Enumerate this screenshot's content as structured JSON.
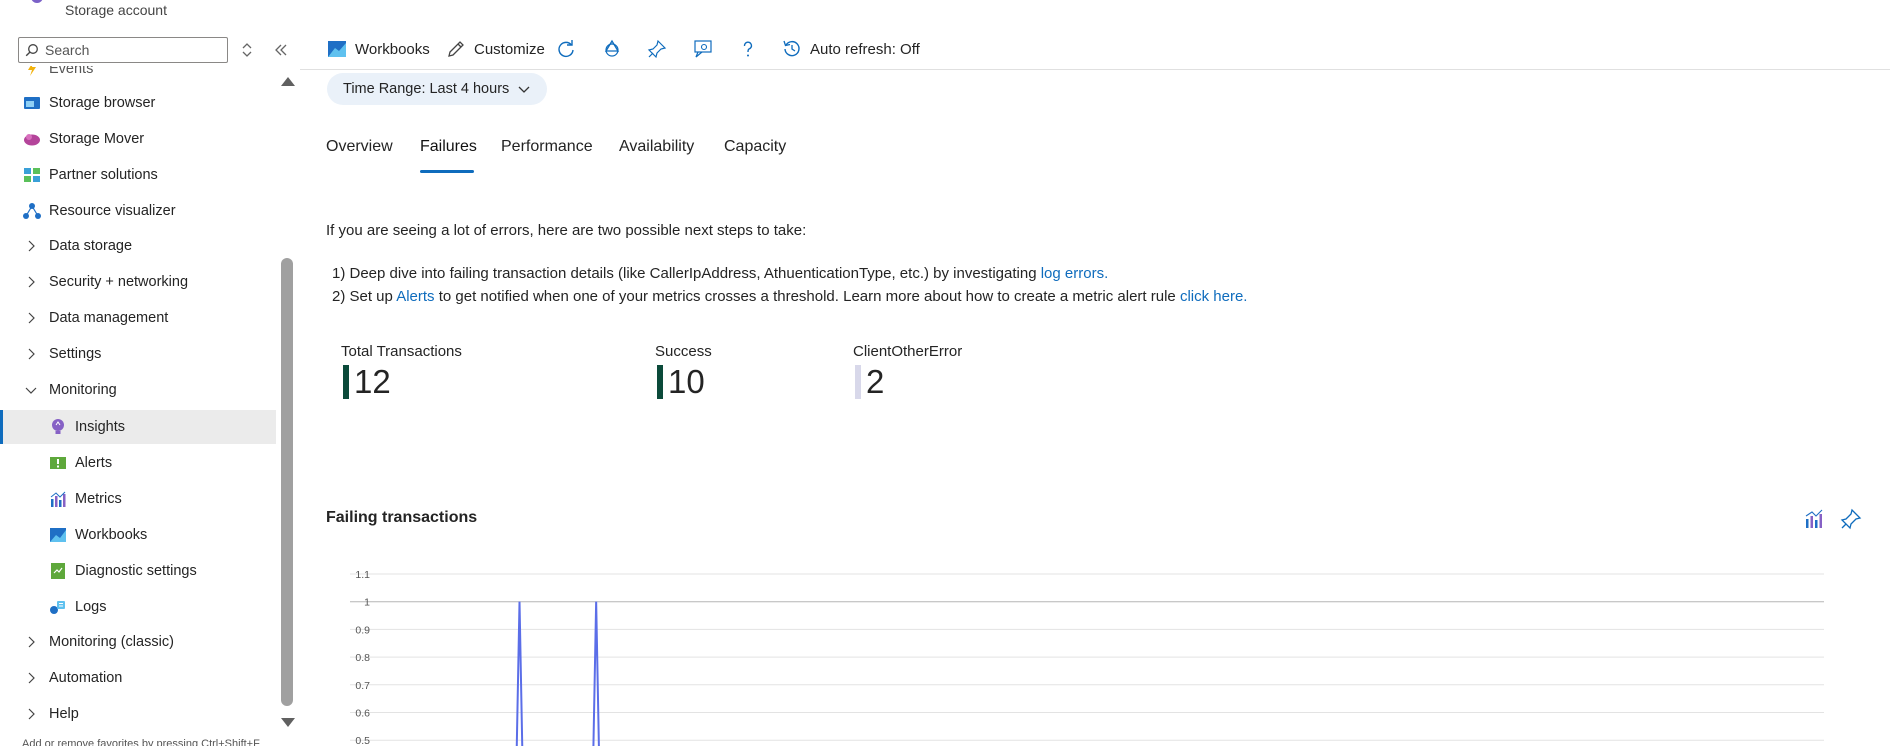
{
  "header": {
    "subtitle": "Storage account"
  },
  "sidebar": {
    "search_placeholder": "Search",
    "items": [
      {
        "label": "Events",
        "type": "item",
        "icon": "events-icon"
      },
      {
        "label": "Storage browser",
        "type": "item",
        "icon": "storage-browser-icon"
      },
      {
        "label": "Storage Mover",
        "type": "item",
        "icon": "storage-mover-icon"
      },
      {
        "label": "Partner solutions",
        "type": "item",
        "icon": "partner-solutions-icon"
      },
      {
        "label": "Resource visualizer",
        "type": "item",
        "icon": "resource-visualizer-icon"
      },
      {
        "label": "Data storage",
        "type": "group",
        "expanded": false
      },
      {
        "label": "Security + networking",
        "type": "group",
        "expanded": false
      },
      {
        "label": "Data management",
        "type": "group",
        "expanded": false
      },
      {
        "label": "Settings",
        "type": "group",
        "expanded": false
      },
      {
        "label": "Monitoring",
        "type": "group",
        "expanded": true
      },
      {
        "label": "Insights",
        "type": "subitem",
        "icon": "insights-icon",
        "selected": true
      },
      {
        "label": "Alerts",
        "type": "subitem",
        "icon": "alerts-icon"
      },
      {
        "label": "Metrics",
        "type": "subitem",
        "icon": "metrics-icon"
      },
      {
        "label": "Workbooks",
        "type": "subitem",
        "icon": "workbooks-icon"
      },
      {
        "label": "Diagnostic settings",
        "type": "subitem",
        "icon": "diagnostic-settings-icon"
      },
      {
        "label": "Logs",
        "type": "subitem",
        "icon": "logs-icon"
      },
      {
        "label": "Monitoring (classic)",
        "type": "group",
        "expanded": false
      },
      {
        "label": "Automation",
        "type": "group",
        "expanded": false
      },
      {
        "label": "Help",
        "type": "group",
        "expanded": false
      }
    ],
    "footer_hint": "Add or remove favorites by pressing Ctrl+Shift+F"
  },
  "toolbar": {
    "workbooks_label": "Workbooks",
    "customize_label": "Customize",
    "auto_refresh_label": "Auto refresh: Off"
  },
  "time_range": {
    "key": "Time Range:",
    "value": "Last 4 hours"
  },
  "tabs": [
    "Overview",
    "Failures",
    "Performance",
    "Availability",
    "Capacity"
  ],
  "active_tab": "Failures",
  "guidance": {
    "intro": "If you are seeing a lot of errors, here are two possible next steps to take:",
    "step1_text": "1) Deep dive into failing transaction details (like CallerIpAddress, AthuenticationType, etc.) by investigating ",
    "step1_link": "log errors.",
    "step2_prefix": "2) Set up ",
    "step2_link1": "Alerts",
    "step2_middle": " to get notified when one of your metrics crosses a threshold. Learn more about how to create a metric alert rule ",
    "step2_link2": "click here."
  },
  "tiles": [
    {
      "label": "Total Transactions",
      "value": "12",
      "color": "#0b4a3a"
    },
    {
      "label": "Success",
      "value": "10",
      "color": "#0b4a3a"
    },
    {
      "label": "ClientOtherError",
      "value": "2",
      "color": "#d8d8ea"
    }
  ],
  "chart_title": "Failing transactions",
  "chart_data": {
    "type": "line",
    "ylim": [
      0.4,
      1.1
    ],
    "yticks": [
      "1.1",
      "1",
      "0.9",
      "0.8",
      "0.7",
      "0.6",
      "0.5"
    ],
    "series": [
      {
        "color": "#5b6ee8",
        "spikes_at_x_fraction": [
          0.115,
          0.167
        ],
        "peak": 1
      }
    ],
    "grid": true
  },
  "colors": {
    "accent": "#0f6cbd",
    "series_line": "#5b6ee8"
  }
}
